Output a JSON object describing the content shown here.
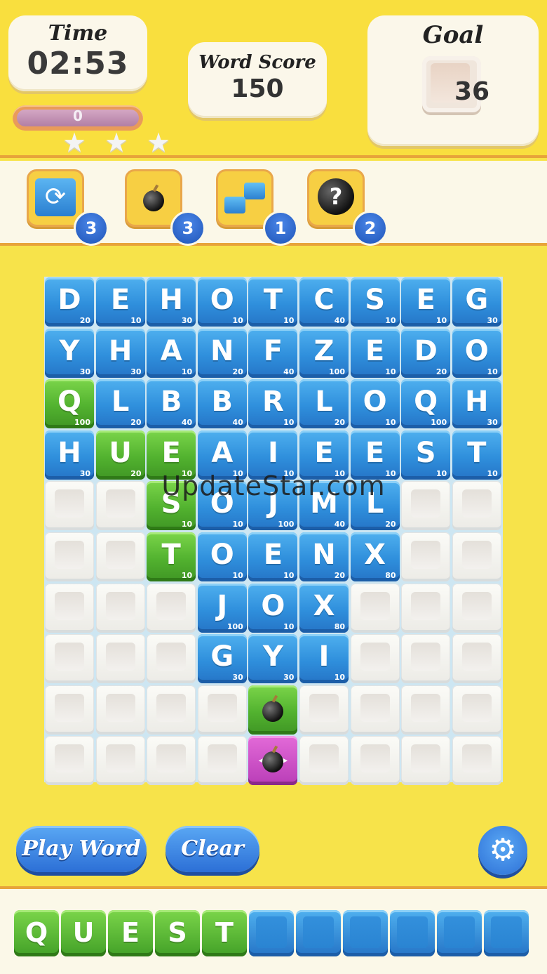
{
  "header": {
    "time_label": "Time",
    "time_value": "02:53",
    "score_label": "Word Score",
    "score_value": "150",
    "goal_label": "Goal",
    "goal_value": "36",
    "progress_value": "0",
    "stars_total": 3
  },
  "powerups": [
    {
      "name": "shuffle",
      "icon": "shuffle-icon",
      "count": "3"
    },
    {
      "name": "bomb",
      "icon": "bomb-icon",
      "count": "3"
    },
    {
      "name": "swap",
      "icon": "swap-icon",
      "count": "1"
    },
    {
      "name": "mystery-bomb",
      "icon": "mystery-bomb-icon",
      "count": "2"
    }
  ],
  "board": {
    "cols": 9,
    "rows": [
      [
        [
          "D",
          "20",
          "blue"
        ],
        [
          "E",
          "10",
          "blue"
        ],
        [
          "H",
          "30",
          "blue"
        ],
        [
          "O",
          "10",
          "blue"
        ],
        [
          "T",
          "10",
          "blue"
        ],
        [
          "C",
          "40",
          "blue"
        ],
        [
          "S",
          "10",
          "blue"
        ],
        [
          "E",
          "10",
          "blue"
        ],
        [
          "G",
          "30",
          "blue"
        ]
      ],
      [
        [
          "Y",
          "30",
          "blue"
        ],
        [
          "H",
          "30",
          "blue"
        ],
        [
          "A",
          "10",
          "blue"
        ],
        [
          "N",
          "20",
          "blue"
        ],
        [
          "F",
          "40",
          "blue"
        ],
        [
          "Z",
          "100",
          "blue"
        ],
        [
          "E",
          "10",
          "blue"
        ],
        [
          "D",
          "20",
          "blue"
        ],
        [
          "O",
          "10",
          "blue"
        ]
      ],
      [
        [
          "Q",
          "100",
          "green"
        ],
        [
          "L",
          "20",
          "blue"
        ],
        [
          "B",
          "40",
          "blue"
        ],
        [
          "B",
          "40",
          "blue"
        ],
        [
          "R",
          "10",
          "blue"
        ],
        [
          "L",
          "20",
          "blue"
        ],
        [
          "O",
          "10",
          "blue"
        ],
        [
          "Q",
          "100",
          "blue"
        ],
        [
          "H",
          "30",
          "blue"
        ]
      ],
      [
        [
          "H",
          "30",
          "blue"
        ],
        [
          "U",
          "20",
          "green"
        ],
        [
          "E",
          "10",
          "green"
        ],
        [
          "A",
          "10",
          "blue"
        ],
        [
          "I",
          "10",
          "blue"
        ],
        [
          "E",
          "10",
          "blue"
        ],
        [
          "E",
          "10",
          "blue"
        ],
        [
          "S",
          "10",
          "blue"
        ],
        [
          "T",
          "10",
          "blue"
        ]
      ],
      [
        [
          "",
          "",
          "white"
        ],
        [
          "",
          "",
          "white"
        ],
        [
          "S",
          "10",
          "green"
        ],
        [
          "O",
          "10",
          "blue"
        ],
        [
          "J",
          "100",
          "blue"
        ],
        [
          "M",
          "40",
          "blue"
        ],
        [
          "L",
          "20",
          "blue"
        ],
        [
          "",
          "",
          "white"
        ],
        [
          "",
          "",
          "white"
        ]
      ],
      [
        [
          "",
          "",
          "white"
        ],
        [
          "",
          "",
          "white"
        ],
        [
          "T",
          "10",
          "green"
        ],
        [
          "O",
          "10",
          "blue"
        ],
        [
          "E",
          "10",
          "blue"
        ],
        [
          "N",
          "20",
          "blue"
        ],
        [
          "X",
          "80",
          "blue"
        ],
        [
          "",
          "",
          "white"
        ],
        [
          "",
          "",
          "white"
        ]
      ],
      [
        [
          "",
          "",
          "white"
        ],
        [
          "",
          "",
          "white"
        ],
        [
          "",
          "",
          "white"
        ],
        [
          "J",
          "100",
          "blue"
        ],
        [
          "O",
          "10",
          "blue"
        ],
        [
          "X",
          "80",
          "blue"
        ],
        [
          "",
          "",
          "white"
        ],
        [
          "",
          "",
          "white"
        ],
        [
          "",
          "",
          "white"
        ]
      ],
      [
        [
          "",
          "",
          "white"
        ],
        [
          "",
          "",
          "white"
        ],
        [
          "",
          "",
          "white"
        ],
        [
          "G",
          "30",
          "blue"
        ],
        [
          "Y",
          "30",
          "blue"
        ],
        [
          "I",
          "10",
          "blue"
        ],
        [
          "",
          "",
          "white"
        ],
        [
          "",
          "",
          "white"
        ],
        [
          "",
          "",
          "white"
        ]
      ],
      [
        [
          "",
          "",
          "white"
        ],
        [
          "",
          "",
          "white"
        ],
        [
          "",
          "",
          "white"
        ],
        [
          "",
          "",
          "white"
        ],
        [
          "bomb",
          "",
          "green"
        ],
        [
          "",
          "",
          "white"
        ],
        [
          "",
          "",
          "white"
        ],
        [
          "",
          "",
          "white"
        ],
        [
          "",
          "",
          "white"
        ]
      ],
      [
        [
          "",
          "",
          "white"
        ],
        [
          "",
          "",
          "white"
        ],
        [
          "",
          "",
          "white"
        ],
        [
          "",
          "",
          "white"
        ],
        [
          "bomb-swap",
          "",
          "magenta"
        ],
        [
          "",
          "",
          "white"
        ],
        [
          "",
          "",
          "white"
        ],
        [
          "",
          "",
          "white"
        ],
        [
          "",
          "",
          "white"
        ]
      ]
    ]
  },
  "watermark": "UpdateStar.com",
  "buttons": {
    "play_word": "Play Word",
    "clear": "Clear",
    "settings_icon": "gear-icon"
  },
  "tray": {
    "letters": [
      "Q",
      "U",
      "E",
      "S",
      "T"
    ],
    "empty_slots": 6
  },
  "colors": {
    "background": "#f7e34a",
    "tile_blue": "#2f8fdc",
    "tile_green": "#52b22f",
    "tile_magenta": "#b93db7",
    "badge_blue": "#1f55b8"
  }
}
